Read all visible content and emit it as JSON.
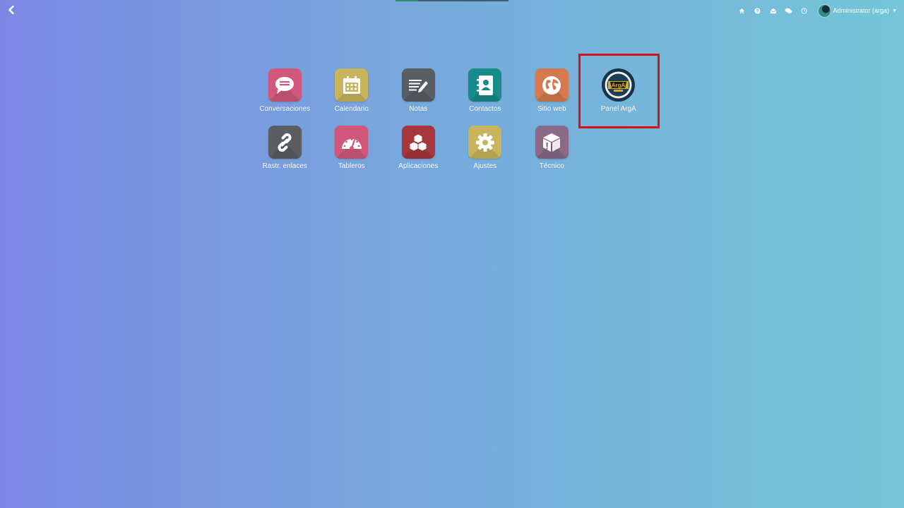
{
  "topbar": {
    "back_icon": "chevron-left-icon",
    "systray": [
      {
        "icon": "home-icon"
      },
      {
        "icon": "help-icon"
      },
      {
        "icon": "mail-icon"
      },
      {
        "icon": "chat-icon"
      },
      {
        "icon": "clock-icon"
      }
    ],
    "user_name": "Administrator (arga)"
  },
  "apps": [
    {
      "label": "Conversaciones",
      "icon": "chat-bubble-icon",
      "color": "#d1587c"
    },
    {
      "label": "Calendario",
      "icon": "calendar-icon",
      "color": "#c8b45c"
    },
    {
      "label": "Notas",
      "icon": "notes-icon",
      "color": "#5a5e63"
    },
    {
      "label": "Contactos",
      "icon": "address-book-icon",
      "color": "#178c8a"
    },
    {
      "label": "Sitio web",
      "icon": "globe-icon",
      "color": "#d47a4e"
    },
    {
      "label": "Panel ArgA",
      "icon": "arga-logo-icon",
      "color": "#16344a",
      "logo_text": "ArgA"
    },
    {
      "label": "Rastr. enlaces",
      "icon": "link-icon",
      "color": "#5a5e63"
    },
    {
      "label": "Tableros",
      "icon": "dashboard-gauge-icon",
      "color": "#d1587c"
    },
    {
      "label": "Aplicaciones",
      "icon": "cubes-icon",
      "color": "#a6373c"
    },
    {
      "label": "Ajustes",
      "icon": "gear-icon",
      "color": "#c8b45c"
    },
    {
      "label": "Técnico",
      "icon": "package-warning-icon",
      "color": "#8a6a86"
    }
  ]
}
